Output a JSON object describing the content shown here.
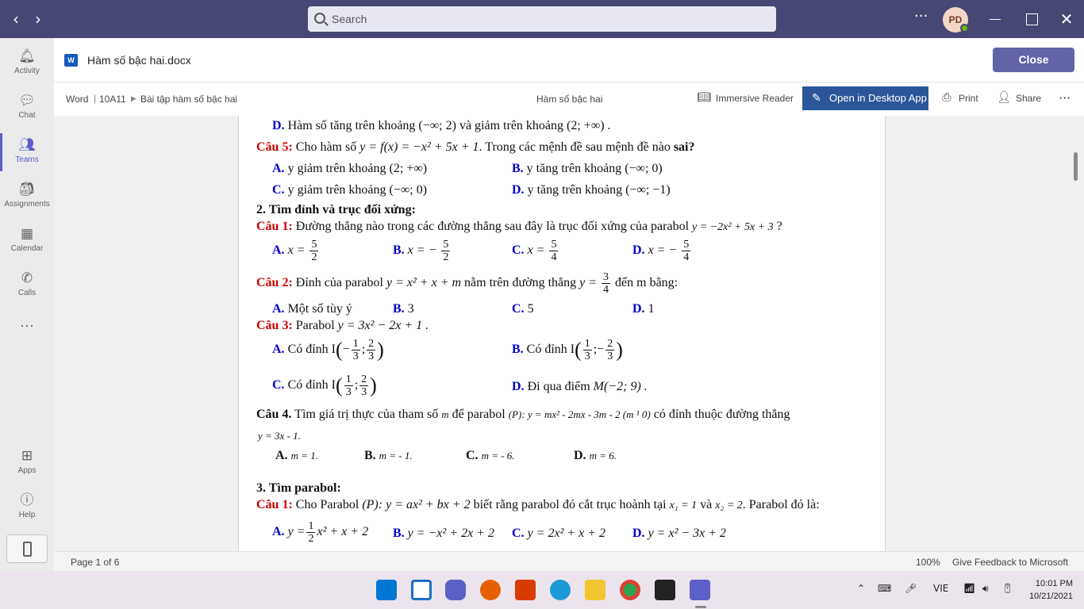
{
  "topbar": {
    "back": "‹",
    "forward": "›",
    "search_placeholder": "Search",
    "more": "···",
    "avatar_initials": "PD"
  },
  "rail": {
    "items": [
      {
        "label": "Activity",
        "icon": "bell-icon"
      },
      {
        "label": "Chat",
        "icon": "chat-icon"
      },
      {
        "label": "Teams",
        "icon": "teams-icon"
      },
      {
        "label": "Assignments",
        "icon": "assignments-icon"
      },
      {
        "label": "Calendar",
        "icon": "calendar-icon"
      },
      {
        "label": "Calls",
        "icon": "phone-icon"
      },
      {
        "label": "Apps",
        "icon": "apps-icon"
      },
      {
        "label": "Help",
        "icon": "help-icon"
      }
    ],
    "more": "···"
  },
  "file": {
    "title": "Hàm số bậc hai.docx",
    "close_label": "Close"
  },
  "toolbar": {
    "breadcrumb": [
      "Word",
      "10A11",
      "Bài tập hàm số bậc hai"
    ],
    "doc_title": "Hàm số bậc hai",
    "immersive_reader": "Immersive Reader",
    "open_desktop": "Open in Desktop App",
    "print": "Print",
    "share": "Share"
  },
  "doc": {
    "l1_label": "D.",
    "l1_text": "Hàm số tăng trên khoảng (−∞; 2) và giảm trên khoảng (2; +∞) .",
    "c5_label": "Câu 5:",
    "c5_text_a": "Cho hàm số",
    "c5_math": "y = f(x) = −x² + 5x + 1",
    "c5_text_b": ". Trong các mệnh đề sau mệnh đề nào",
    "c5_bold": "sai",
    "c5_q": "?",
    "c5_A": "y giảm trên khoảng (2; +∞)",
    "c5_B": "y tăng trên khoảng (−∞; 0)",
    "c5_C": "y giảm trên khoảng (−∞; 0)",
    "c5_D": "y tăng trên khoảng (−∞; −1)",
    "sec2": "2. Tìm đỉnh và trục đối xứng:",
    "s2c1_label": "Câu 1:",
    "s2c1_text": "Đường thẳng nào trong các đường thẳng sau đây là trục đối xứng của parabol",
    "s2c1_math": "y = −2x² + 5x + 3",
    "s2c1_q": "?",
    "s2c1_opts": {
      "A": "x =",
      "B": "x = −",
      "C": "x =",
      "D": "x = −"
    },
    "s2c1_fracs": [
      [
        "5",
        "2"
      ],
      [
        "5",
        "2"
      ],
      [
        "5",
        "4"
      ],
      [
        "5",
        "4"
      ]
    ],
    "s2c2_label": "Câu 2:",
    "s2c2_text_a": "Đỉnh của parabol",
    "s2c2_math": "y = x² + x + m",
    "s2c2_text_b": "nằm trên đường thẳng",
    "s2c2_line": "y =",
    "s2c2_frac": [
      "3",
      "4"
    ],
    "s2c2_text_c": "đến m bằng:",
    "s2c2_A": "Một số tùy ý",
    "s2c2_B": "3",
    "s2c2_C": "5",
    "s2c2_D": "1",
    "s2c3_label": "Câu 3:",
    "s2c3_text": "Parabol",
    "s2c3_math": "y = 3x² − 2x + 1 .",
    "s2c3_A": "Có đỉnh I",
    "s2c3_A_frac": [
      [
        "1",
        "3"
      ],
      [
        "2",
        "3"
      ]
    ],
    "s2c3_B": "Có đỉnh I",
    "s2c3_B_frac": [
      [
        "1",
        "3"
      ],
      [
        "2",
        "3"
      ]
    ],
    "s2c3_C": "Có đỉnh I",
    "s2c3_C_frac": [
      [
        "1",
        "3"
      ],
      [
        "2",
        "3"
      ]
    ],
    "s2c3_D": "Đi qua điểm",
    "s2c3_D_math": "M(−2; 9) .",
    "s2c4_label": "Câu 4.",
    "s2c4_text_a": "Tìm giá trị thực của tham số",
    "s2c4_m": "m",
    "s2c4_text_b": "để parabol",
    "s2c4_math": "(P): y = mx² - 2mx - 3m - 2  (m ¹ 0)",
    "s2c4_text_c": "có đỉnh thuộc đường thẳng",
    "s2c4_line2": "y = 3x - 1.",
    "s2c4_A": "m = 1.",
    "s2c4_B": "m = - 1.",
    "s2c4_C": "m = - 6.",
    "s2c4_D": "m = 6.",
    "sec3": "3. Tìm parabol:",
    "s3c1_label": "Câu 1:",
    "s3c1_text_a": "Cho Parabol",
    "s3c1_math": "(P): y = ax² + bx + 2",
    "s3c1_text_b": "biết rằng parabol đó cắt trục hoành tại",
    "s3c1_x1": "x₁ = 1",
    "s3c1_and": "và",
    "s3c1_x2": "x₂ = 2",
    "s3c1_text_c": ". Parabol đó là:",
    "s3c1_A_pre": "y =",
    "s3c1_A_frac": [
      "1",
      "2"
    ],
    "s3c1_A_post": "x² + x + 2",
    "s3c1_B": "y = −x² + 2x + 2",
    "s3c1_C": "y = 2x² + x + 2",
    "s3c1_D": "y = x² − 3x + 2",
    "labels": {
      "A": "A.",
      "B": "B.",
      "C": "C.",
      "D": "D."
    }
  },
  "status": {
    "page": "Page 1 of 6",
    "zoom": "100%",
    "feedback": "Give Feedback to Microsoft"
  },
  "taskbar": {
    "lang": "VIE",
    "time": "10:01 PM",
    "date": "10/21/2021"
  }
}
